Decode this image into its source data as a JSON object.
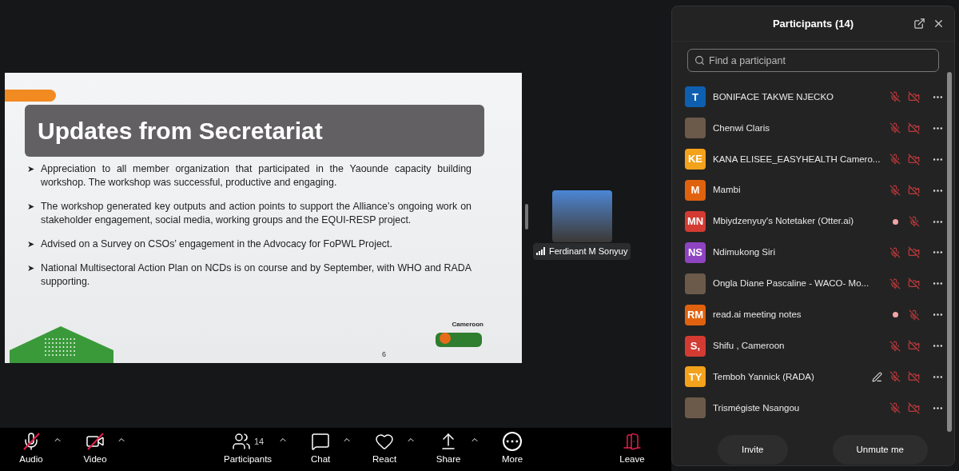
{
  "slide": {
    "title": "Updates from Secretariat",
    "bullet_marker": "➤",
    "bullets": [
      "Appreciation to all member organization that participated in the Yaounde capacity  building workshop. The workshop was successful, productive and engaging.",
      "The workshop generated key outputs and action points to support the Alliance’s ongoing work on stakeholder engagement, social media, working groups and the EQUI-RESP project.",
      "Advised on a Survey on CSOs’ engagement in the Advocacy for FoPWL Project.",
      "National Multisectoral Action Plan on NCDs is on course and by September, with WHO and RADA supporting."
    ],
    "logo_caption": "Cameroon",
    "page_number": "6"
  },
  "video_tile": {
    "name": "Ferdinant M Sonyuy"
  },
  "participants_panel": {
    "title": "Participants (14)",
    "search": {
      "placeholder": "Find a participant"
    },
    "participants": [
      {
        "kind": "initials",
        "initials": "T",
        "color": "#0f5fb0",
        "name": "BONIFACE TAKWE NJECKO",
        "recording": false,
        "annotating": false,
        "video_off": true
      },
      {
        "kind": "photo",
        "name": "Chenwi Claris",
        "recording": false,
        "annotating": false,
        "video_off": true
      },
      {
        "kind": "initials",
        "initials": "KE",
        "color": "#f3a21b",
        "name": "KANA ELISEE_EASYHEALTH Camero...",
        "recording": false,
        "annotating": false,
        "video_off": true
      },
      {
        "kind": "initials",
        "initials": "M",
        "color": "#e0620f",
        "name": "Mambi",
        "recording": false,
        "annotating": false,
        "video_off": true
      },
      {
        "kind": "initials",
        "initials": "MN",
        "color": "#d33b32",
        "name": "Mbiydzenyuy's Notetaker (Otter.ai)",
        "recording": true,
        "annotating": false,
        "video_off": false
      },
      {
        "kind": "initials",
        "initials": "NS",
        "color": "#8e44c0",
        "name": "Ndimukong Siri",
        "recording": false,
        "annotating": false,
        "video_off": true
      },
      {
        "kind": "photo",
        "name": "Ongla Diane Pascaline - WACO- Mo...",
        "recording": false,
        "annotating": false,
        "video_off": true
      },
      {
        "kind": "initials",
        "initials": "RM",
        "color": "#e0620f",
        "name": "read.ai meeting notes",
        "recording": true,
        "annotating": false,
        "video_off": false
      },
      {
        "kind": "initials",
        "initials": "S,",
        "color": "#d33b32",
        "name": "Shifu , Cameroon",
        "recording": false,
        "annotating": false,
        "video_off": true
      },
      {
        "kind": "initials",
        "initials": "TY",
        "color": "#f3a21b",
        "name": "Temboh Yannick (RADA)",
        "recording": false,
        "annotating": true,
        "video_off": true
      },
      {
        "kind": "photo",
        "name": "Trismégiste Nsangou",
        "recording": false,
        "annotating": false,
        "video_off": true
      }
    ],
    "buttons": [
      "Invite",
      "Unmute me"
    ]
  },
  "toolbar": [
    {
      "kind": "audio",
      "label": "Audio",
      "caret": true,
      "off": true
    },
    {
      "kind": "video",
      "label": "Video",
      "caret": true,
      "off": true
    },
    {
      "kind": "participants",
      "label": "Participants",
      "count": "14",
      "caret": true,
      "off": false
    },
    {
      "kind": "chat",
      "label": "Chat",
      "caret": true,
      "off": false
    },
    {
      "kind": "react",
      "label": "React",
      "caret": true,
      "off": false
    },
    {
      "kind": "share",
      "label": "Share",
      "caret": true,
      "off": false
    },
    {
      "kind": "more",
      "label": "More",
      "caret": false,
      "off": false
    },
    {
      "kind": "leave",
      "label": "Leave",
      "caret": false,
      "off": false
    }
  ]
}
